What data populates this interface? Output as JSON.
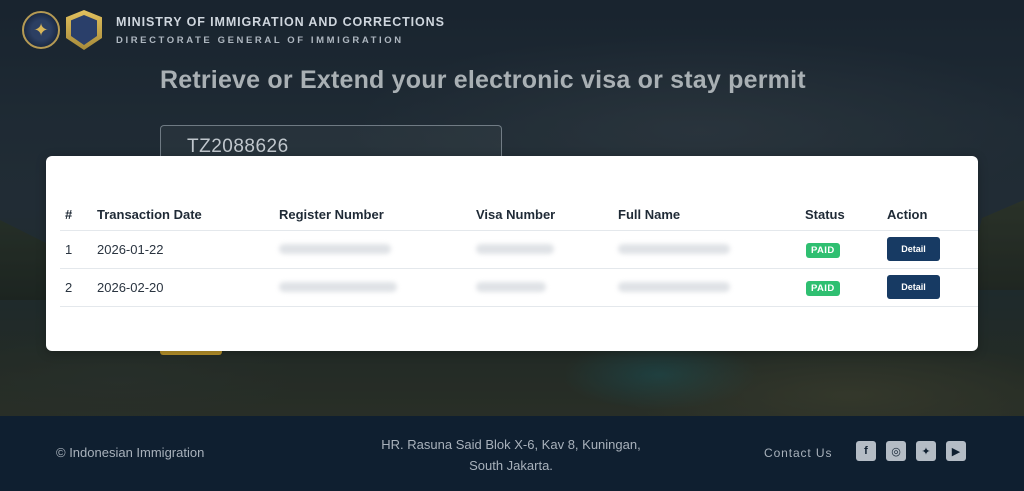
{
  "header": {
    "ministry": "MINISTRY OF IMMIGRATION AND CORRECTIONS",
    "directorate": "DIRECTORATE GENERAL OF IMMIGRATION"
  },
  "hero": {
    "heading": "Retrieve or Extend your electronic visa or stay permit",
    "search_value": "TZ2088626"
  },
  "table": {
    "columns": [
      "#",
      "Transaction Date",
      "Register Number",
      "Visa Number",
      "Full Name",
      "Status",
      "Action"
    ],
    "rows": [
      {
        "num": "1",
        "date": "2026-01-22",
        "status": "PAID",
        "action": "Detail"
      },
      {
        "num": "2",
        "date": "2026-02-20",
        "status": "PAID",
        "action": "Detail"
      }
    ]
  },
  "footer": {
    "copyright": "© Indonesian Immigration",
    "address_line1": "HR. Rasuna Said Blok X-6, Kav 8, Kuningan,",
    "address_line2": "South Jakarta.",
    "contact": "Contact Us",
    "socials": [
      "facebook-icon",
      "instagram-icon",
      "twitter-icon",
      "youtube-icon"
    ]
  },
  "colors": {
    "footer_bg": "#0f1f30",
    "paid_badge": "#2fbf71",
    "detail_button": "#173a63"
  }
}
